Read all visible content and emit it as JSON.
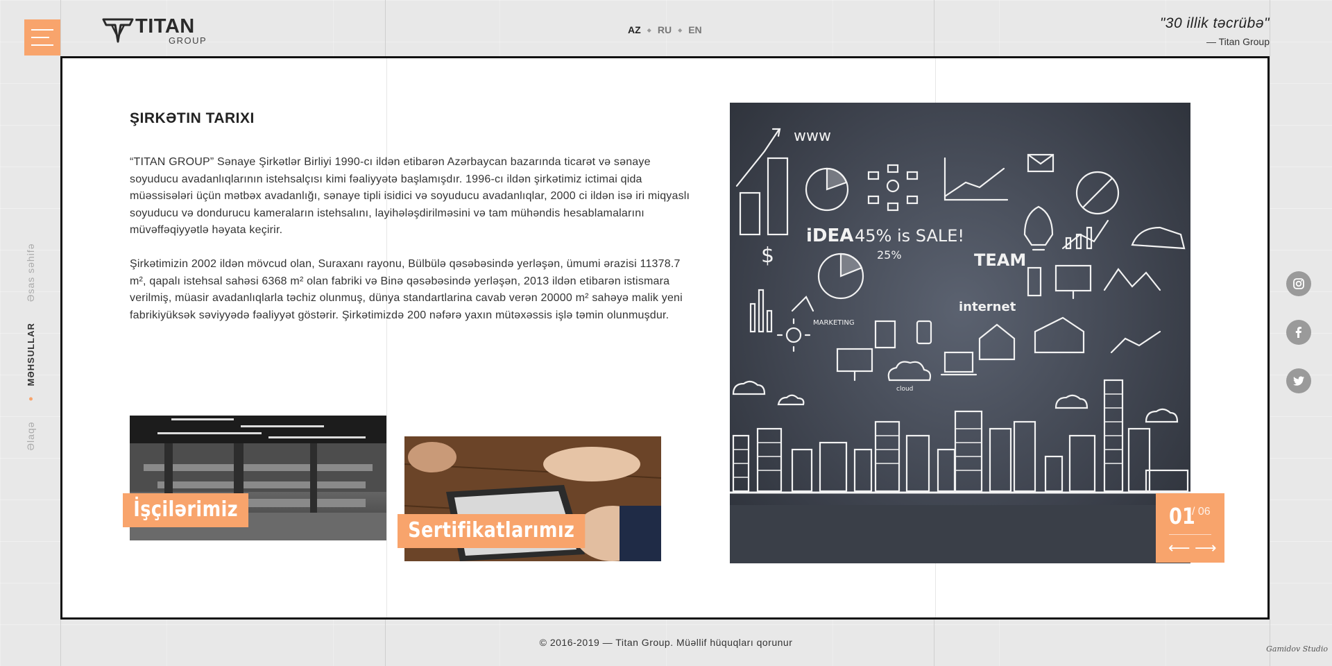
{
  "header": {
    "logo": {
      "brand": "TITAN",
      "sub": "GROUP"
    },
    "languages": [
      "AZ",
      "RU",
      "EN"
    ],
    "active_language": "AZ",
    "quote": {
      "text": "\"30 illik təcrübə\"",
      "author": "— Titan Group"
    }
  },
  "side_nav": {
    "items": [
      "Əsas səhifə",
      "Məhsullar",
      "Əlaqə"
    ],
    "active": "Məhsullar"
  },
  "main": {
    "title": "ŞIRKƏTIN TARIXI",
    "paragraphs": [
      "“TITAN GROUP” Sənaye Şirkətlər Birliyi 1990-cı ildən etibarən Azərbaycan bazarında ticarət və sənaye soyuducu avadanlıqlarının istehsalçısı kimi fəaliyyətə başlamışdır. 1996-cı ildən şirkətimiz ictimai qida müəssisələri üçün mətbəx avadanlığı, sənaye tipli isidici və soyuducu avadanlıqlar, 2000 ci ildən isə iri miqyaslı soyuducu və dondurucu kameraların istehsalını, layihələşdirilməsini və tam mühəndis hesablamalarını müvəffəqiyyətlə həyata keçirir.",
      "Şirkətimizin 2002 ildən mövcud olan, Suraxanı rayonu, Bülbülə qəsəbəsində yerləşən, ümumi ərazisi 11378.7 m², qapalı istehsal sahəsi 6368 m² olan fabriki və  Binə qəsəbəsində yerləşən, 2013 ildən etibarən istismara verilmiş, müasir avadanlıqlarla təchiz olunmuş, dünya standartlarina cavab verən 20000 m² sahəyə malik yeni fabrikiyüksək səviyyədə fəaliyyət göstərir. Şirkətimizdə 200 nəfərə yaxın mütəxəssis işlə təmin olunmuşdur."
    ],
    "cards": [
      {
        "label": "İşçilərimiz"
      },
      {
        "label": "Sertifikatlarımız"
      }
    ],
    "hero_words": [
      "www",
      "iDEA",
      "45% is SALE!",
      "TEAM",
      "25%",
      "internet",
      "MARKETING",
      "cloud"
    ],
    "slider": {
      "current": "01",
      "total": "/ 06",
      "prev": "⟵",
      "next": "⟶"
    }
  },
  "socials": [
    "instagram-icon",
    "facebook-icon",
    "twitter-icon"
  ],
  "footer": {
    "copyright": "© 2016-2019 — Titan Group. Müəllif hüquqları qorunur",
    "studio": "Gamidov Studio"
  },
  "colors": {
    "accent": "#f8a46c",
    "frame": "#111111",
    "background": "#e8e8e8"
  }
}
